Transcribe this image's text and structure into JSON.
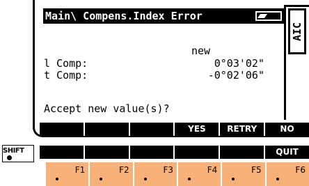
{
  "screen": {
    "title": "Main\\ Compens.Index Error",
    "side_label": "AIC",
    "column_header": "new",
    "rows": [
      {
        "label": "l Comp:",
        "value": "0°03'02\""
      },
      {
        "label": "t Comp:",
        "value": "-0°02'06\""
      }
    ],
    "prompt": "Accept new value(s)?"
  },
  "softkeys": [
    "",
    "",
    "",
    "YES",
    "RETRY",
    "NO"
  ],
  "shift_softkeys": [
    "",
    "",
    "",
    "",
    "",
    "QUIT"
  ],
  "shift_label": "SHIFT",
  "fkeys": [
    "F1",
    "F2",
    "F3",
    "F4",
    "F5",
    "F6"
  ],
  "colors": {
    "fkey_bg": "#f8b279",
    "lcd_bg": "#ffffff",
    "ink": "#000000"
  }
}
